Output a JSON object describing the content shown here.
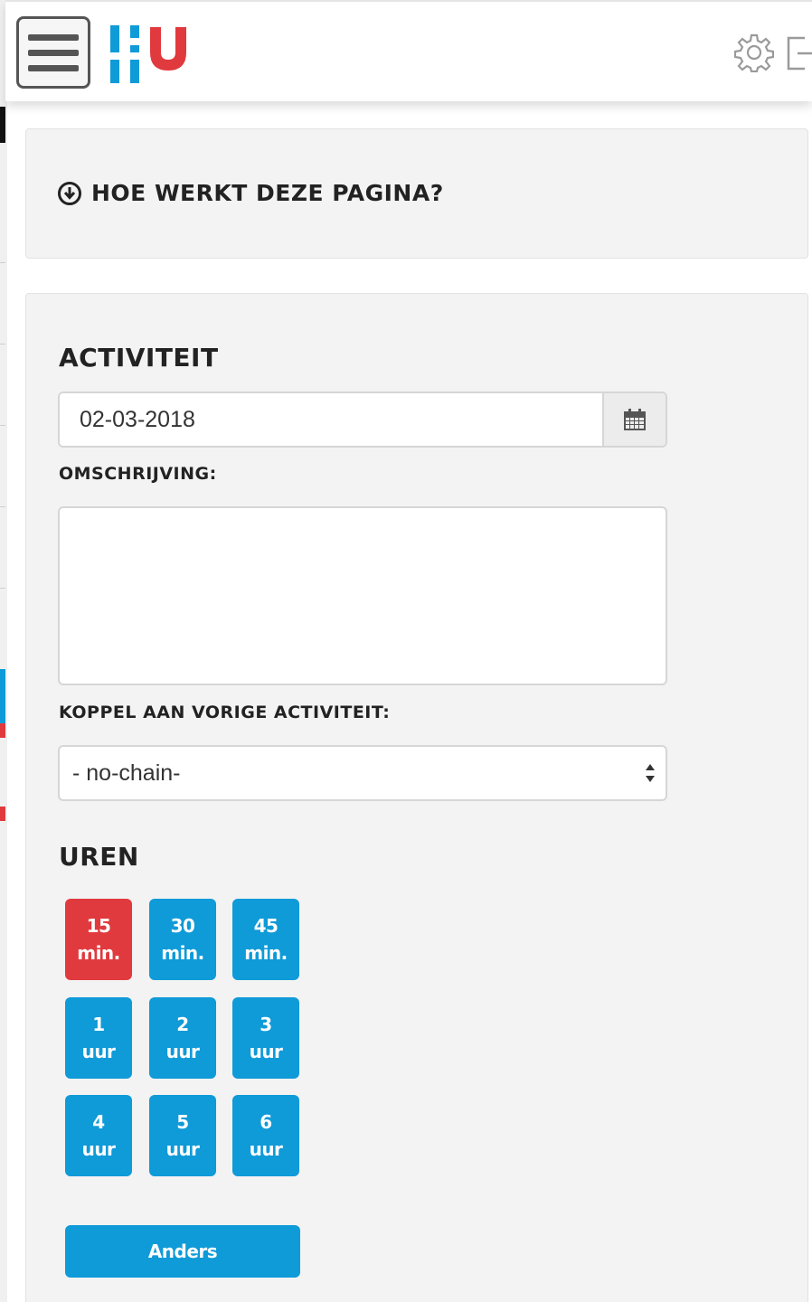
{
  "header": {
    "menu_icon": "hamburger-icon",
    "logo_text": "HU",
    "settings_icon": "gear-icon",
    "logout_icon": "logout-icon"
  },
  "help": {
    "icon": "circle-down-icon",
    "title": "HOE WERKT DEZE PAGINA?"
  },
  "activity": {
    "title": "ACTIVITEIT",
    "date_value": "02-03-2018",
    "calendar_icon": "calendar-icon",
    "description_label": "OMSCHRIJVING:",
    "description_value": "",
    "chain_label": "KOPPEL AAN VORIGE ACTIVITEIT:",
    "chain_value": "- no-chain-"
  },
  "hours": {
    "title": "UREN",
    "buttons": [
      {
        "amount": "15",
        "unit": "min.",
        "selected": true
      },
      {
        "amount": "30",
        "unit": "min.",
        "selected": false
      },
      {
        "amount": "45",
        "unit": "min.",
        "selected": false
      },
      {
        "amount": "1",
        "unit": "uur",
        "selected": false
      },
      {
        "amount": "2",
        "unit": "uur",
        "selected": false
      },
      {
        "amount": "3",
        "unit": "uur",
        "selected": false
      },
      {
        "amount": "4",
        "unit": "uur",
        "selected": false
      },
      {
        "amount": "5",
        "unit": "uur",
        "selected": false
      },
      {
        "amount": "6",
        "unit": "uur",
        "selected": false
      }
    ],
    "other_label": "Anders"
  },
  "colors": {
    "accent_blue": "#0f9ad8",
    "accent_red": "#e03a3e",
    "panel_bg": "#f3f3f3"
  }
}
